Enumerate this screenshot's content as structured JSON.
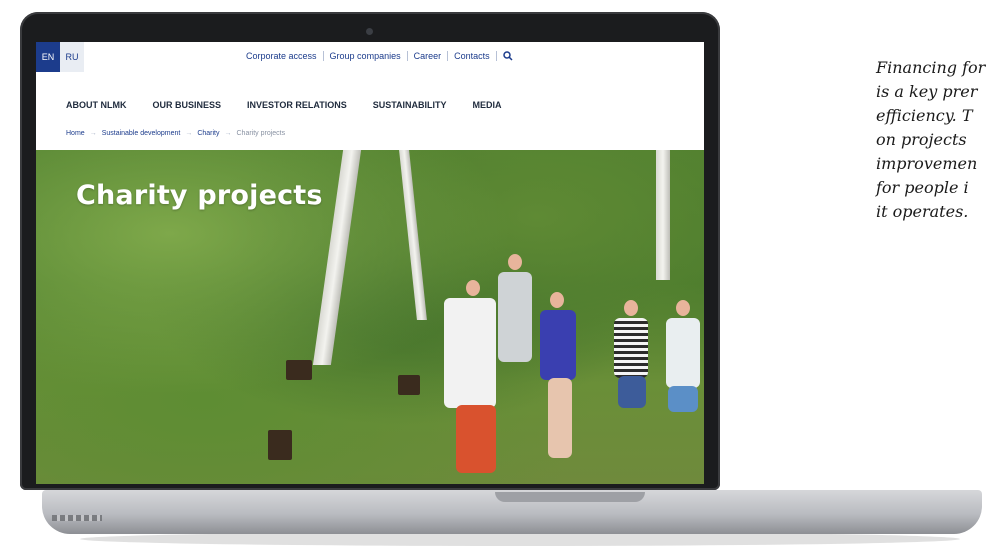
{
  "website": {
    "languages": [
      {
        "label": "EN",
        "active": true
      },
      {
        "label": "RU",
        "active": false
      }
    ],
    "utility_nav": [
      "Corporate access",
      "Group companies",
      "Career",
      "Contacts"
    ],
    "main_nav": [
      "ABOUT NLMK",
      "OUR BUSINESS",
      "INVESTOR RELATIONS",
      "SUSTAINABILITY",
      "MEDIA"
    ],
    "breadcrumb": [
      "Home",
      "Sustainable development",
      "Charity",
      "Charity projects"
    ],
    "hero_title": "Charity projects"
  },
  "quote_lines": [
    "Financing for",
    "is a key prer",
    "efficiency. T",
    "on projects",
    "improvemen",
    "for people i",
    "it operates."
  ],
  "colors": {
    "brand_blue": "#1c3c8c",
    "nav_text": "#1f2b3d"
  },
  "icons": {
    "search": "search-icon"
  }
}
